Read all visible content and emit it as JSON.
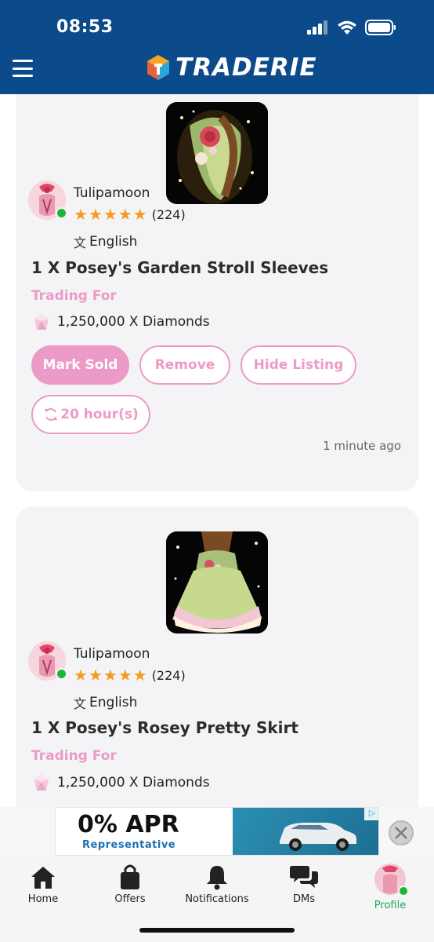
{
  "status_bar": {
    "time": "08:53"
  },
  "header": {
    "brand": "TRADERIE"
  },
  "listings": [
    {
      "seller": "Tulipamoon",
      "rating_count": "(224)",
      "rating_stars": 5,
      "language": "English",
      "title": "1 X Posey's Garden Stroll Sleeves",
      "trading_for_label": "Trading For",
      "price": "1,250,000 X Diamonds",
      "actions": {
        "mark_sold": "Mark Sold",
        "remove": "Remove",
        "hide": "Hide Listing",
        "renew": "20 hour(s)"
      },
      "posted": "1 minute ago"
    },
    {
      "seller": "Tulipamoon",
      "rating_count": "(224)",
      "rating_stars": 5,
      "language": "English",
      "title": "1 X Posey's Rosey Pretty Skirt",
      "trading_for_label": "Trading For",
      "price": "1,250,000 X Diamonds"
    }
  ],
  "ad": {
    "headline": "0% APR",
    "subline": "Representative"
  },
  "tabs": {
    "home": "Home",
    "offers": "Offers",
    "notifications": "Notifications",
    "dms": "DMs",
    "profile": "Profile"
  },
  "colors": {
    "header_bg": "#0b4a8b",
    "accent_pink": "#ec9ac7",
    "star_orange": "#f39c1e",
    "online_green": "#1fb33c",
    "active_tab": "#1ea85a"
  }
}
